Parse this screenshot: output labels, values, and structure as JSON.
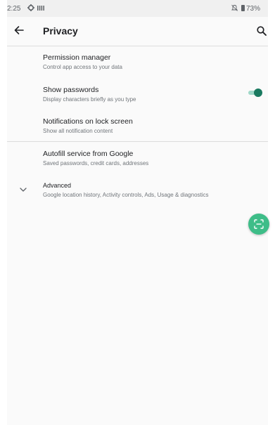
{
  "status_bar": {
    "time": "2:25",
    "battery": "73%"
  },
  "app_bar": {
    "title": "Privacy"
  },
  "preferences": [
    {
      "title": "Permission manager",
      "summary": "Control app access to your data"
    },
    {
      "title": "Show passwords",
      "summary": "Display characters briefly as you type",
      "toggle_on": true
    },
    {
      "title": "Notifications on lock screen",
      "summary": "Show all notification content"
    },
    {
      "title": "Autofill service from Google",
      "summary": "Saved passwords, credit cards, addresses"
    },
    {
      "title": "Advanced",
      "summary": "Google location history, Activity controls, Ads, Usage & diagnostics"
    }
  ],
  "icons": {
    "back": "arrow-back-icon",
    "search": "search-icon",
    "expand": "chevron-down-icon",
    "fab": "scan-icon",
    "settings": "gear-icon",
    "signal": "signal-bars-icon",
    "mute": "mute-icon",
    "battery": "battery-icon"
  },
  "colors": {
    "accent": "#1a7a60",
    "toggle_track": "#9fd8c8",
    "fab": "#3ebd88"
  }
}
